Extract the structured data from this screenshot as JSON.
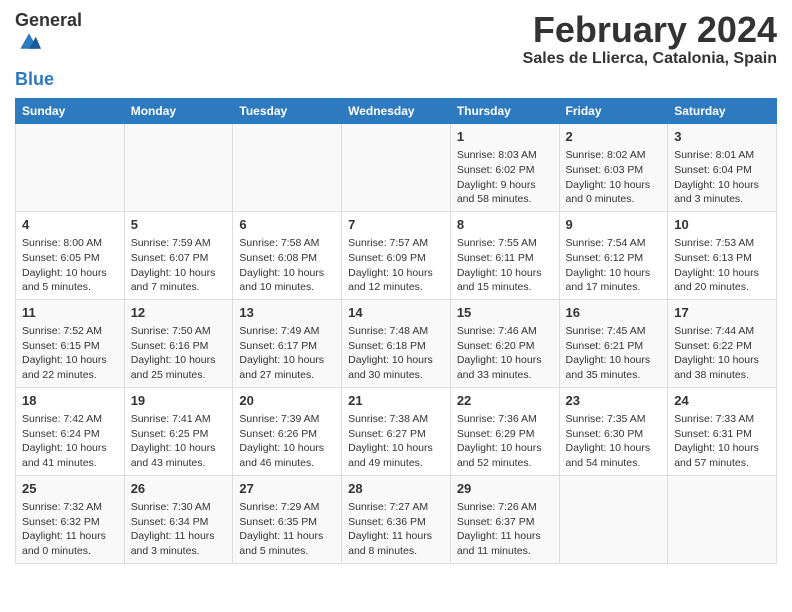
{
  "header": {
    "logo_general": "General",
    "logo_blue": "Blue",
    "main_title": "February 2024",
    "subtitle": "Sales de Llierca, Catalonia, Spain"
  },
  "days_of_week": [
    "Sunday",
    "Monday",
    "Tuesday",
    "Wednesday",
    "Thursday",
    "Friday",
    "Saturday"
  ],
  "weeks": [
    [
      {
        "day": "",
        "info": ""
      },
      {
        "day": "",
        "info": ""
      },
      {
        "day": "",
        "info": ""
      },
      {
        "day": "",
        "info": ""
      },
      {
        "day": "1",
        "info": "Sunrise: 8:03 AM\nSunset: 6:02 PM\nDaylight: 9 hours\nand 58 minutes."
      },
      {
        "day": "2",
        "info": "Sunrise: 8:02 AM\nSunset: 6:03 PM\nDaylight: 10 hours\nand 0 minutes."
      },
      {
        "day": "3",
        "info": "Sunrise: 8:01 AM\nSunset: 6:04 PM\nDaylight: 10 hours\nand 3 minutes."
      }
    ],
    [
      {
        "day": "4",
        "info": "Sunrise: 8:00 AM\nSunset: 6:05 PM\nDaylight: 10 hours\nand 5 minutes."
      },
      {
        "day": "5",
        "info": "Sunrise: 7:59 AM\nSunset: 6:07 PM\nDaylight: 10 hours\nand 7 minutes."
      },
      {
        "day": "6",
        "info": "Sunrise: 7:58 AM\nSunset: 6:08 PM\nDaylight: 10 hours\nand 10 minutes."
      },
      {
        "day": "7",
        "info": "Sunrise: 7:57 AM\nSunset: 6:09 PM\nDaylight: 10 hours\nand 12 minutes."
      },
      {
        "day": "8",
        "info": "Sunrise: 7:55 AM\nSunset: 6:11 PM\nDaylight: 10 hours\nand 15 minutes."
      },
      {
        "day": "9",
        "info": "Sunrise: 7:54 AM\nSunset: 6:12 PM\nDaylight: 10 hours\nand 17 minutes."
      },
      {
        "day": "10",
        "info": "Sunrise: 7:53 AM\nSunset: 6:13 PM\nDaylight: 10 hours\nand 20 minutes."
      }
    ],
    [
      {
        "day": "11",
        "info": "Sunrise: 7:52 AM\nSunset: 6:15 PM\nDaylight: 10 hours\nand 22 minutes."
      },
      {
        "day": "12",
        "info": "Sunrise: 7:50 AM\nSunset: 6:16 PM\nDaylight: 10 hours\nand 25 minutes."
      },
      {
        "day": "13",
        "info": "Sunrise: 7:49 AM\nSunset: 6:17 PM\nDaylight: 10 hours\nand 27 minutes."
      },
      {
        "day": "14",
        "info": "Sunrise: 7:48 AM\nSunset: 6:18 PM\nDaylight: 10 hours\nand 30 minutes."
      },
      {
        "day": "15",
        "info": "Sunrise: 7:46 AM\nSunset: 6:20 PM\nDaylight: 10 hours\nand 33 minutes."
      },
      {
        "day": "16",
        "info": "Sunrise: 7:45 AM\nSunset: 6:21 PM\nDaylight: 10 hours\nand 35 minutes."
      },
      {
        "day": "17",
        "info": "Sunrise: 7:44 AM\nSunset: 6:22 PM\nDaylight: 10 hours\nand 38 minutes."
      }
    ],
    [
      {
        "day": "18",
        "info": "Sunrise: 7:42 AM\nSunset: 6:24 PM\nDaylight: 10 hours\nand 41 minutes."
      },
      {
        "day": "19",
        "info": "Sunrise: 7:41 AM\nSunset: 6:25 PM\nDaylight: 10 hours\nand 43 minutes."
      },
      {
        "day": "20",
        "info": "Sunrise: 7:39 AM\nSunset: 6:26 PM\nDaylight: 10 hours\nand 46 minutes."
      },
      {
        "day": "21",
        "info": "Sunrise: 7:38 AM\nSunset: 6:27 PM\nDaylight: 10 hours\nand 49 minutes."
      },
      {
        "day": "22",
        "info": "Sunrise: 7:36 AM\nSunset: 6:29 PM\nDaylight: 10 hours\nand 52 minutes."
      },
      {
        "day": "23",
        "info": "Sunrise: 7:35 AM\nSunset: 6:30 PM\nDaylight: 10 hours\nand 54 minutes."
      },
      {
        "day": "24",
        "info": "Sunrise: 7:33 AM\nSunset: 6:31 PM\nDaylight: 10 hours\nand 57 minutes."
      }
    ],
    [
      {
        "day": "25",
        "info": "Sunrise: 7:32 AM\nSunset: 6:32 PM\nDaylight: 11 hours\nand 0 minutes."
      },
      {
        "day": "26",
        "info": "Sunrise: 7:30 AM\nSunset: 6:34 PM\nDaylight: 11 hours\nand 3 minutes."
      },
      {
        "day": "27",
        "info": "Sunrise: 7:29 AM\nSunset: 6:35 PM\nDaylight: 11 hours\nand 5 minutes."
      },
      {
        "day": "28",
        "info": "Sunrise: 7:27 AM\nSunset: 6:36 PM\nDaylight: 11 hours\nand 8 minutes."
      },
      {
        "day": "29",
        "info": "Sunrise: 7:26 AM\nSunset: 6:37 PM\nDaylight: 11 hours\nand 11 minutes."
      },
      {
        "day": "",
        "info": ""
      },
      {
        "day": "",
        "info": ""
      }
    ]
  ]
}
